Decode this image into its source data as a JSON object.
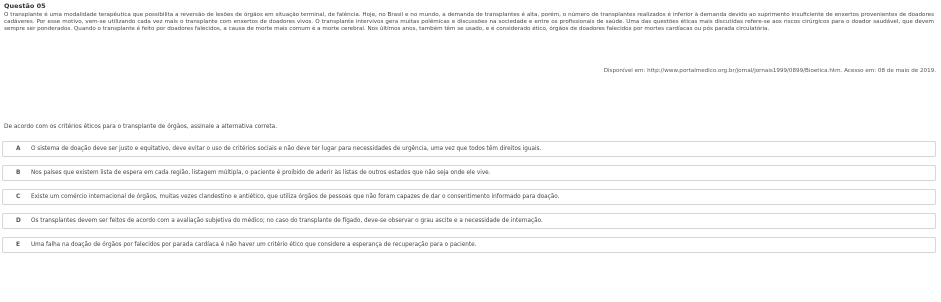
{
  "question": {
    "title": "Questão 05",
    "passage": "O transplante é uma modalidade terapêutica que possibilita a reversão de lesões de órgãos em situação terminal, de falência. Hoje, no Brasil e no mundo, a demanda de transplantes é alta, porém, o número de transplantes realizados é inferior à demanda devido ao suprimento insuficiente de enxertos provenientes de doadores cadáveres. Por esse motivo, vem-se utilizando cada vez mais o transplante com enxertos de doadores vivos. O transplante intervivos gera muitas polêmicas e discussões na sociedade e entre os profissionais de saúde. Uma das questões éticas mais discutidas refere-se aos riscos cirúrgicos para o doador saudável, que devem sempre ser ponderados. Quando o transplante é feito por doadores falecidos, a causa de morte mais comum é a morte cerebral. Nos últimos anos, também têm se usado, e é considerado ético, órgãos de doadores falecidos por mortes cardíacas ou pós parada circulatória.",
    "source": "Disponível em: http://www.portalmedico.org.br/jornal/jornais1999/0899/Bioetica.htm. Acesso em: 08 de maio de 2019.",
    "prompt": "De acordo com os critérios éticos para o transplante de órgãos, assinale a alternativa correta."
  },
  "alternatives": [
    {
      "letter": "A",
      "text": "O sistema de doação deve ser justo e equitativo, deve evitar o uso de critérios sociais e não deve ter lugar para necessidades de urgência, uma vez que todos têm direitos iguais."
    },
    {
      "letter": "B",
      "text": "Nos países que existem lista de espera em cada região, listagem múltipla, o paciente é proibido de aderir às listas de outros estados que não seja onde ele vive."
    },
    {
      "letter": "C",
      "text": "Existe um comércio internacional de órgãos, muitas vezes clandestino e antiético, que utiliza órgãos de pessoas que não foram capazes de dar o consentimento informado para doação."
    },
    {
      "letter": "D",
      "text": "Os transplantes devem ser feitos de acordo com a avaliação subjetiva do médico; no caso do transplante de fígado, deve-se observar o grau ascite e a necessidade de internação."
    },
    {
      "letter": "E",
      "text": "Uma falha na doação de órgãos por falecidos por parada cardíaca é não haver um critério ético que considere a esperança de recuperação para o paciente."
    }
  ]
}
